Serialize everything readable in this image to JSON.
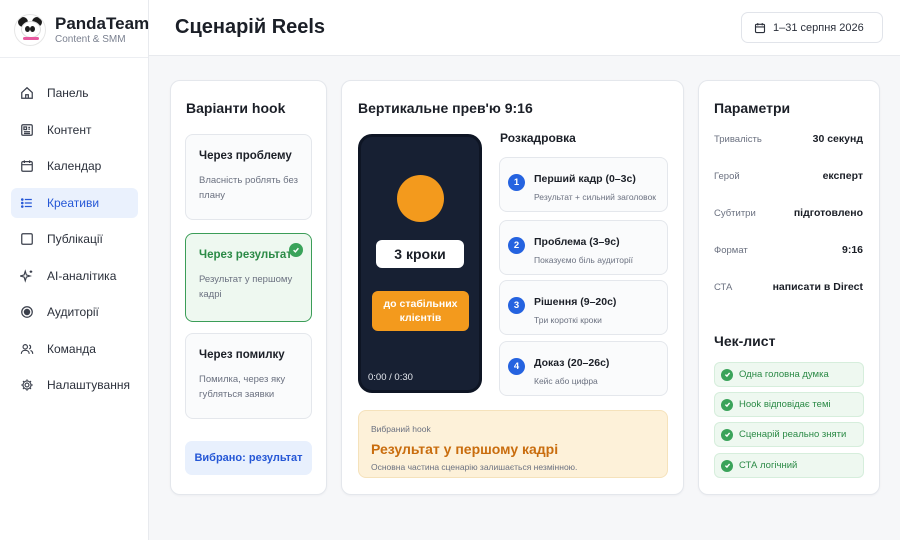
{
  "brand": {
    "name": "PandaTeam",
    "subtitle": "Content & SMM"
  },
  "sidebar": {
    "items": [
      {
        "label": "Панель",
        "icon": "home-icon"
      },
      {
        "label": "Контент",
        "icon": "content-icon"
      },
      {
        "label": "Календар",
        "icon": "calendar-icon"
      },
      {
        "label": "Креативи",
        "icon": "list-icon",
        "active": true
      },
      {
        "label": "Публікації",
        "icon": "square-icon"
      },
      {
        "label": "AI-аналітика",
        "icon": "sparkle-icon"
      },
      {
        "label": "Аудиторії",
        "icon": "target-icon"
      },
      {
        "label": "Команда",
        "icon": "users-icon"
      },
      {
        "label": "Налаштування",
        "icon": "gear-icon"
      }
    ]
  },
  "header": {
    "title": "Сценарій Reels",
    "date_range": "1–31 серпня 2026"
  },
  "hooks": {
    "title": "Варіанти hook",
    "items": [
      {
        "title": "Через проблему",
        "desc": "Власність роблять без плану"
      },
      {
        "title": "Через результат",
        "desc": "Результат у першому кадрі",
        "selected": true
      },
      {
        "title": "Через помилку",
        "desc": "Помилка, через яку губляться заявки"
      }
    ],
    "chosen_label": "Вибрано: результат"
  },
  "preview": {
    "title": "Вертикальне прев'ю 9:16",
    "phone": {
      "chip": "3 кроки",
      "cta": "до стабільних клієнтів",
      "time": "0:00 / 0:30"
    },
    "storyboard_title": "Розкадровка",
    "scenes": [
      {
        "num": "1",
        "title": "Перший кадр (0–3с)",
        "desc": "Результат + сильний заголовок"
      },
      {
        "num": "2",
        "title": "Проблема (3–9с)",
        "desc": "Показуємо біль аудиторії"
      },
      {
        "num": "3",
        "title": "Рішення (9–20с)",
        "desc": "Три короткі кроки"
      },
      {
        "num": "4",
        "title": "Доказ (20–26с)",
        "desc": "Кейс або цифра"
      }
    ],
    "selected_hook": {
      "label": "Вибраний hook",
      "value": "Результат у першому кадрі",
      "note": "Основна частина сценарію залишається незмінною."
    }
  },
  "params": {
    "title": "Параметри",
    "rows": [
      {
        "key": "Тривалість",
        "value": "30 секунд"
      },
      {
        "key": "Герой",
        "value": "експерт"
      },
      {
        "key": "Субтитри",
        "value": "підготовлено"
      },
      {
        "key": "Формат",
        "value": "9:16"
      },
      {
        "key": "СТА",
        "value": "написати в Direct"
      }
    ],
    "checklist_title": "Чек-лист",
    "checklist": [
      "Одна головна думка",
      "Hook відповідає темі",
      "Сценарій реально зняти",
      "СТА логічний"
    ]
  },
  "colors": {
    "accent": "#2557d6",
    "success": "#3aa35a",
    "orange": "#f39a1d",
    "phone_bg": "#172033"
  }
}
